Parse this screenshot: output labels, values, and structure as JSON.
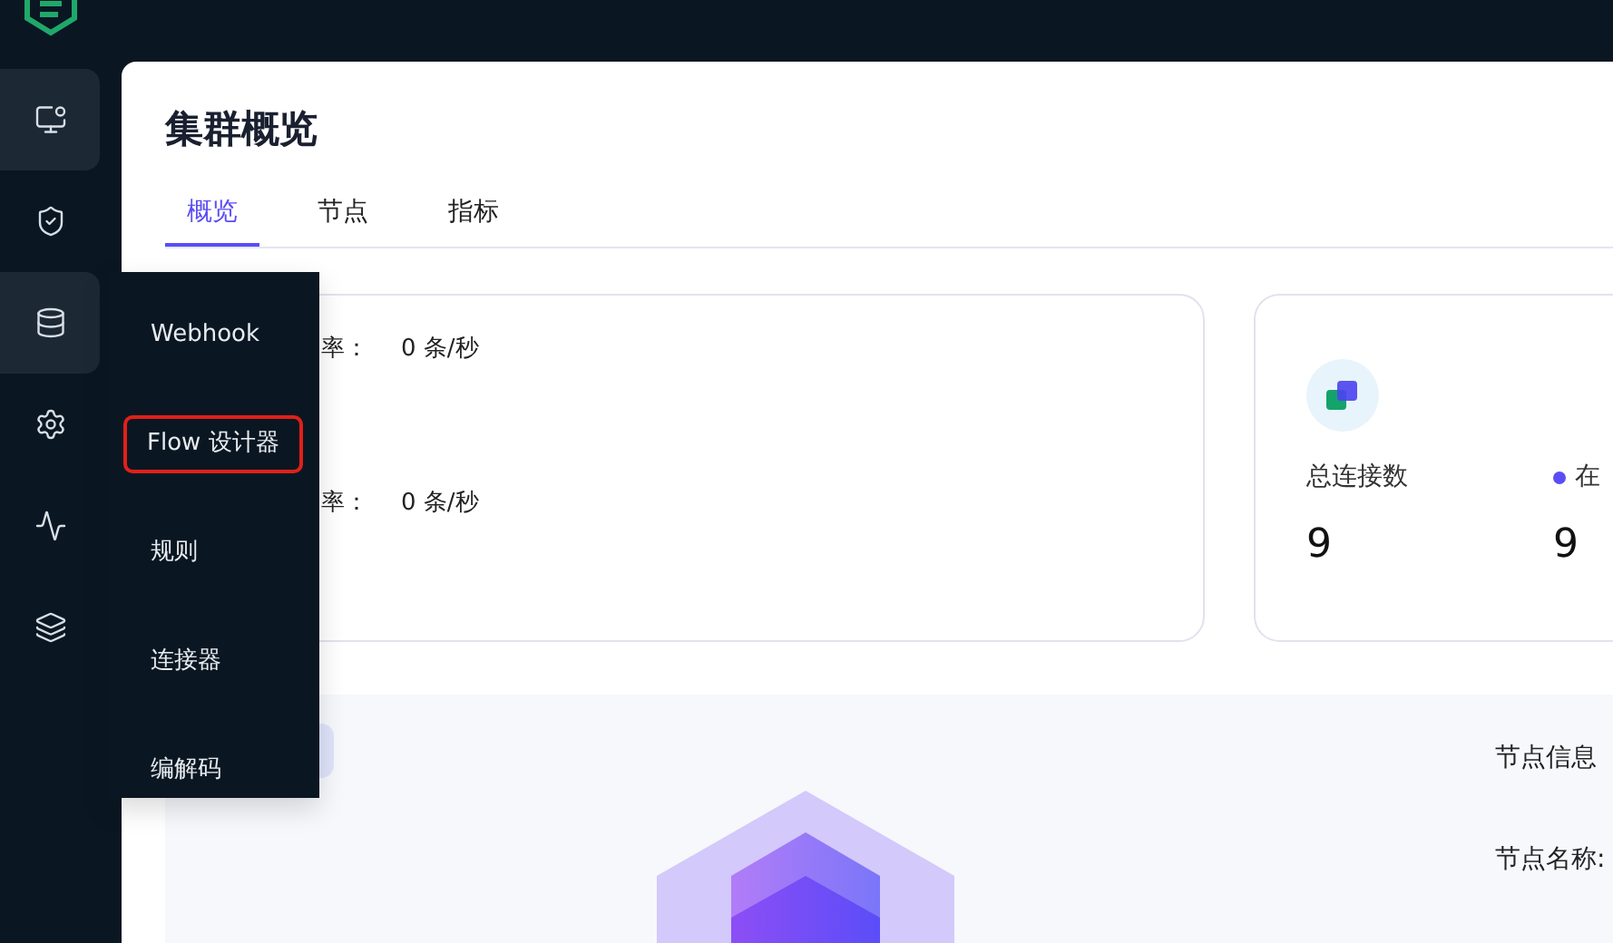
{
  "sidebar": {
    "items": [
      {
        "selected": true
      },
      {
        "selected": false
      },
      {
        "selected": true
      },
      {
        "selected": false
      },
      {
        "selected": false
      },
      {
        "selected": false
      }
    ]
  },
  "flyout_menu": {
    "items": [
      {
        "label": "Webhook",
        "outlined": false
      },
      {
        "label": "Flow 设计器",
        "outlined": true
      },
      {
        "label": "规则",
        "outlined": false
      },
      {
        "label": "连接器",
        "outlined": false
      },
      {
        "label": "编解码",
        "outlined": false
      }
    ]
  },
  "page": {
    "title": "集群概览"
  },
  "tabs": [
    {
      "label": "概览",
      "selected": true
    },
    {
      "label": "节点",
      "selected": false
    },
    {
      "label": "指标",
      "selected": false
    }
  ],
  "rate_card": {
    "rows": [
      {
        "label": "率：",
        "value": "0 条/秒"
      },
      {
        "label": "率：",
        "value": "0 条/秒"
      }
    ]
  },
  "connections_card": {
    "stats": [
      {
        "label": "总连接数",
        "value": "9",
        "dot": false
      },
      {
        "label": "在",
        "value": "9",
        "dot": true
      }
    ]
  },
  "node_panel": {
    "heading": "节点信息",
    "fields": [
      {
        "label": "节点名称:"
      }
    ]
  }
}
